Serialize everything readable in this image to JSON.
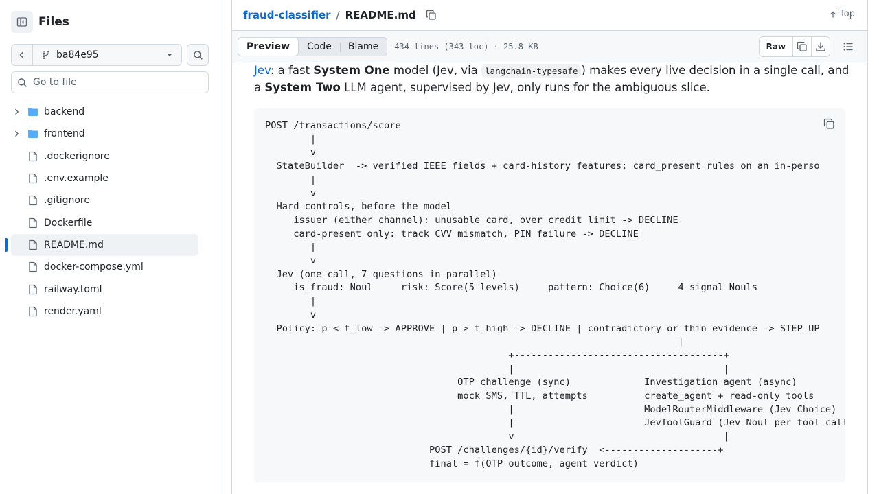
{
  "sidebar": {
    "title": "Files",
    "branch": "ba84e95",
    "goto_placeholder": "Go to file",
    "tree": [
      {
        "type": "folder",
        "label": "backend"
      },
      {
        "type": "folder",
        "label": "frontend"
      },
      {
        "type": "file",
        "label": ".dockerignore"
      },
      {
        "type": "file",
        "label": ".env.example"
      },
      {
        "type": "file",
        "label": ".gitignore"
      },
      {
        "type": "file",
        "label": "Dockerfile"
      },
      {
        "type": "file",
        "label": "README.md",
        "active": true
      },
      {
        "type": "file",
        "label": "docker-compose.yml"
      },
      {
        "type": "file",
        "label": "railway.toml"
      },
      {
        "type": "file",
        "label": "render.yaml"
      }
    ]
  },
  "breadcrumb": {
    "repo": "fraud-classifier",
    "separator": "/",
    "file": "README.md",
    "top_label": "Top"
  },
  "toolbar": {
    "tabs": [
      "Preview",
      "Code",
      "Blame"
    ],
    "active_tab": "Preview",
    "meta": "434 lines (343 loc) · 25.8 KB",
    "raw_label": "Raw"
  },
  "readme": {
    "intro": {
      "link": "Jev",
      "t1": ": a fast ",
      "b1": "System One",
      "t2": " model (Jev, via ",
      "code": "langchain-typesafe",
      "t3": ") makes every live decision in a single call, and a ",
      "b2": "System Two",
      "t4": " LLM agent, supervised by Jev, only runs for the ambiguous slice."
    },
    "code_lines": [
      "POST /transactions/score",
      "        |",
      "        v",
      "  StateBuilder  -> verified IEEE fields + card-history features; card_present rules on an in-perso",
      "        |",
      "        v",
      "  Hard controls, before the model",
      "     issuer (either channel): unusable card, over credit limit -> DECLINE",
      "     card-present only: track CVV mismatch, PIN failure -> DECLINE",
      "        |",
      "        v",
      "  Jev (one call, 7 questions in parallel)",
      "     is_fraud: Noul     risk: Score(5 levels)     pattern: Choice(6)     4 signal Nouls",
      "        |",
      "        v",
      "  Policy: p < t_low -> APPROVE | p > t_high -> DECLINE | contradictory or thin evidence -> STEP_UP",
      "                                                                         |",
      "                                           +-------------------------------------+",
      "                                           |                                     |",
      "                                  OTP challenge (sync)             Investigation agent (async)",
      "                                  mock SMS, TTL, attempts          create_agent + read-only tools",
      "                                           |                       ModelRouterMiddleware (Jev Choice)",
      "                                           |                       JevToolGuard (Jev Noul per tool call",
      "                                           v                                     |",
      "                             POST /challenges/{id}/verify  <--------------------+",
      "                             final = f(OTP outcome, agent verdict)"
    ]
  }
}
